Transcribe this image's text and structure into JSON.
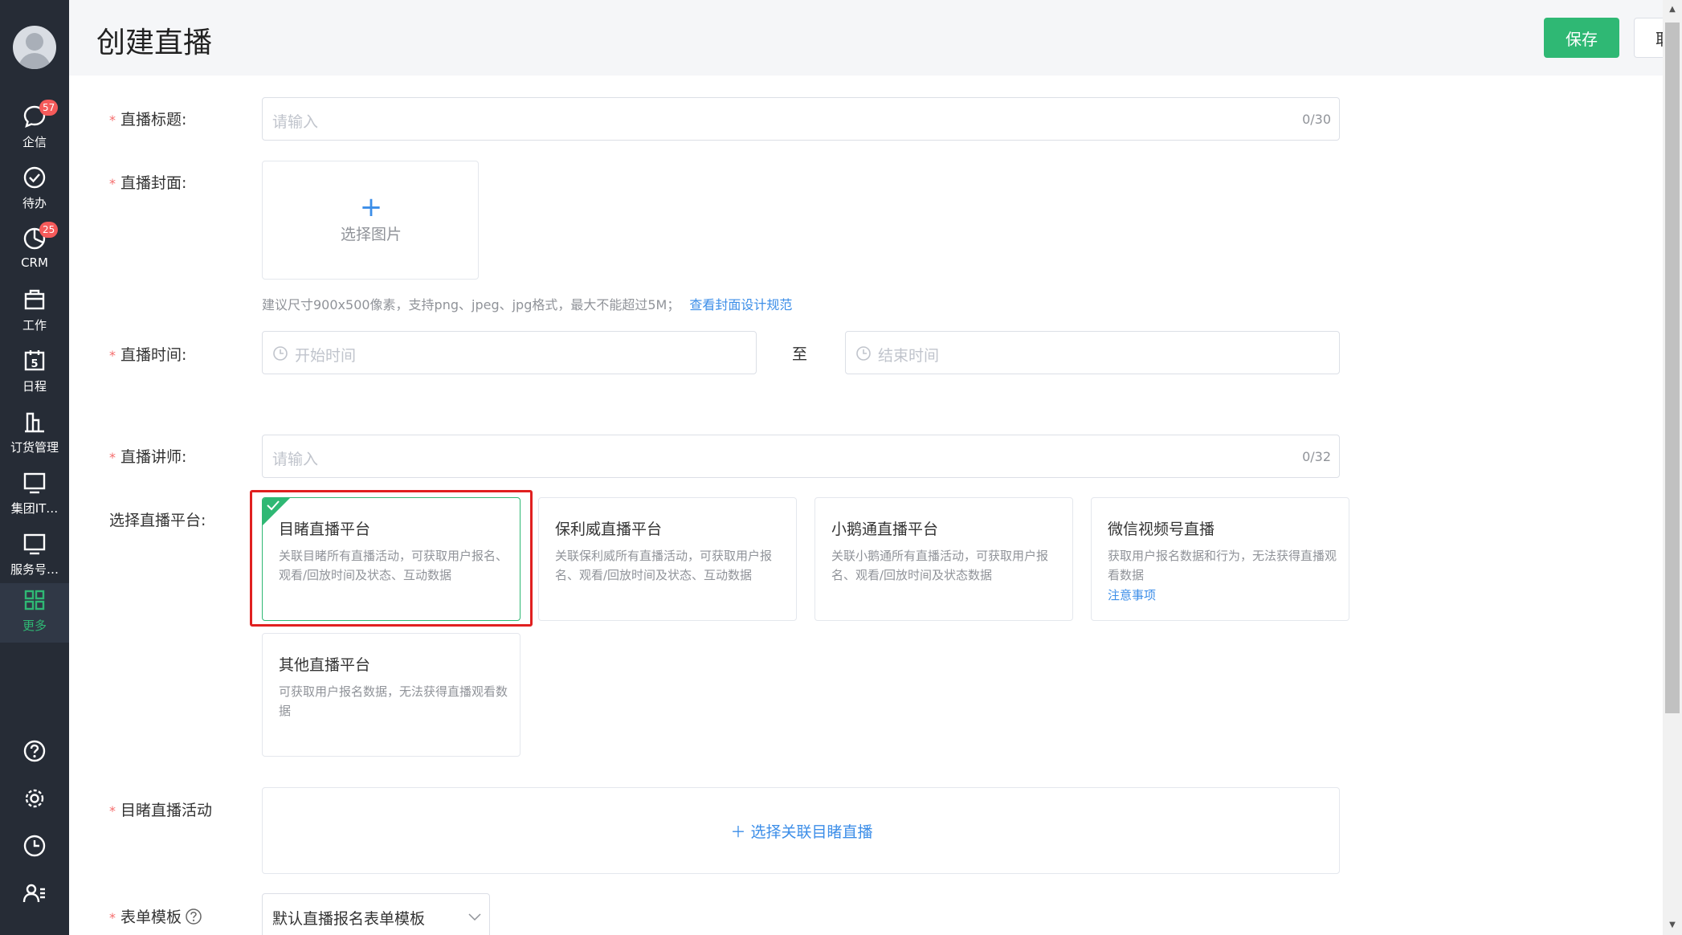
{
  "sidebar": {
    "items": [
      {
        "label": "企信",
        "badge": "57"
      },
      {
        "label": "待办"
      },
      {
        "label": "CRM",
        "badge": "25"
      },
      {
        "label": "工作"
      },
      {
        "label": "日程",
        "icon_text": "5"
      },
      {
        "label": "订货管理"
      },
      {
        "label": "集团IT…"
      },
      {
        "label": "服务号…"
      },
      {
        "label": "更多"
      }
    ]
  },
  "header": {
    "title": "创建直播",
    "save_label": "保存",
    "cancel_label": "取消"
  },
  "form": {
    "title": {
      "label": "直播标题:",
      "placeholder": "请输入",
      "counter": "0/30"
    },
    "cover": {
      "label": "直播封面:",
      "upload_label": "选择图片",
      "hint": "建议尺寸900x500像素，支持png、jpeg、jpg格式，最大不能超过5M；",
      "hint_link": "查看封面设计规范"
    },
    "time": {
      "label": "直播时间:",
      "start_placeholder": "开始时间",
      "separator": "至",
      "end_placeholder": "结束时间"
    },
    "lecturer": {
      "label": "直播讲师:",
      "placeholder": "请输入",
      "counter": "0/32"
    },
    "platform": {
      "label": "选择直播平台:",
      "options": [
        {
          "name": "目睹直播平台",
          "desc": "关联目睹所有直播活动，可获取用户报名、观看/回放时间及状态、互动数据",
          "selected": true
        },
        {
          "name": "保利威直播平台",
          "desc": "关联保利威所有直播活动，可获取用户报名、观看/回放时间及状态、互动数据"
        },
        {
          "name": "小鹅通直播平台",
          "desc": "关联小鹅通所有直播活动，可获取用户报名、观看/回放时间及状态数据"
        },
        {
          "name": "微信视频号直播",
          "desc": "获取用户报名数据和行为，无法获得直播观看数据",
          "note": "注意事项"
        },
        {
          "name": "其他直播平台",
          "desc": "可获取用户报名数据，无法获得直播观看数据"
        }
      ]
    },
    "activity": {
      "label": "目睹直播活动",
      "link": "选择关联目睹直播"
    },
    "template": {
      "label": "表单模板",
      "value": "默认直播报名表单模板"
    }
  },
  "colors": {
    "accent": "#2fb874",
    "link": "#3c8ee8",
    "required": "#f56c6c",
    "sidebar_bg": "#262c36",
    "highlight": "#e02020"
  }
}
